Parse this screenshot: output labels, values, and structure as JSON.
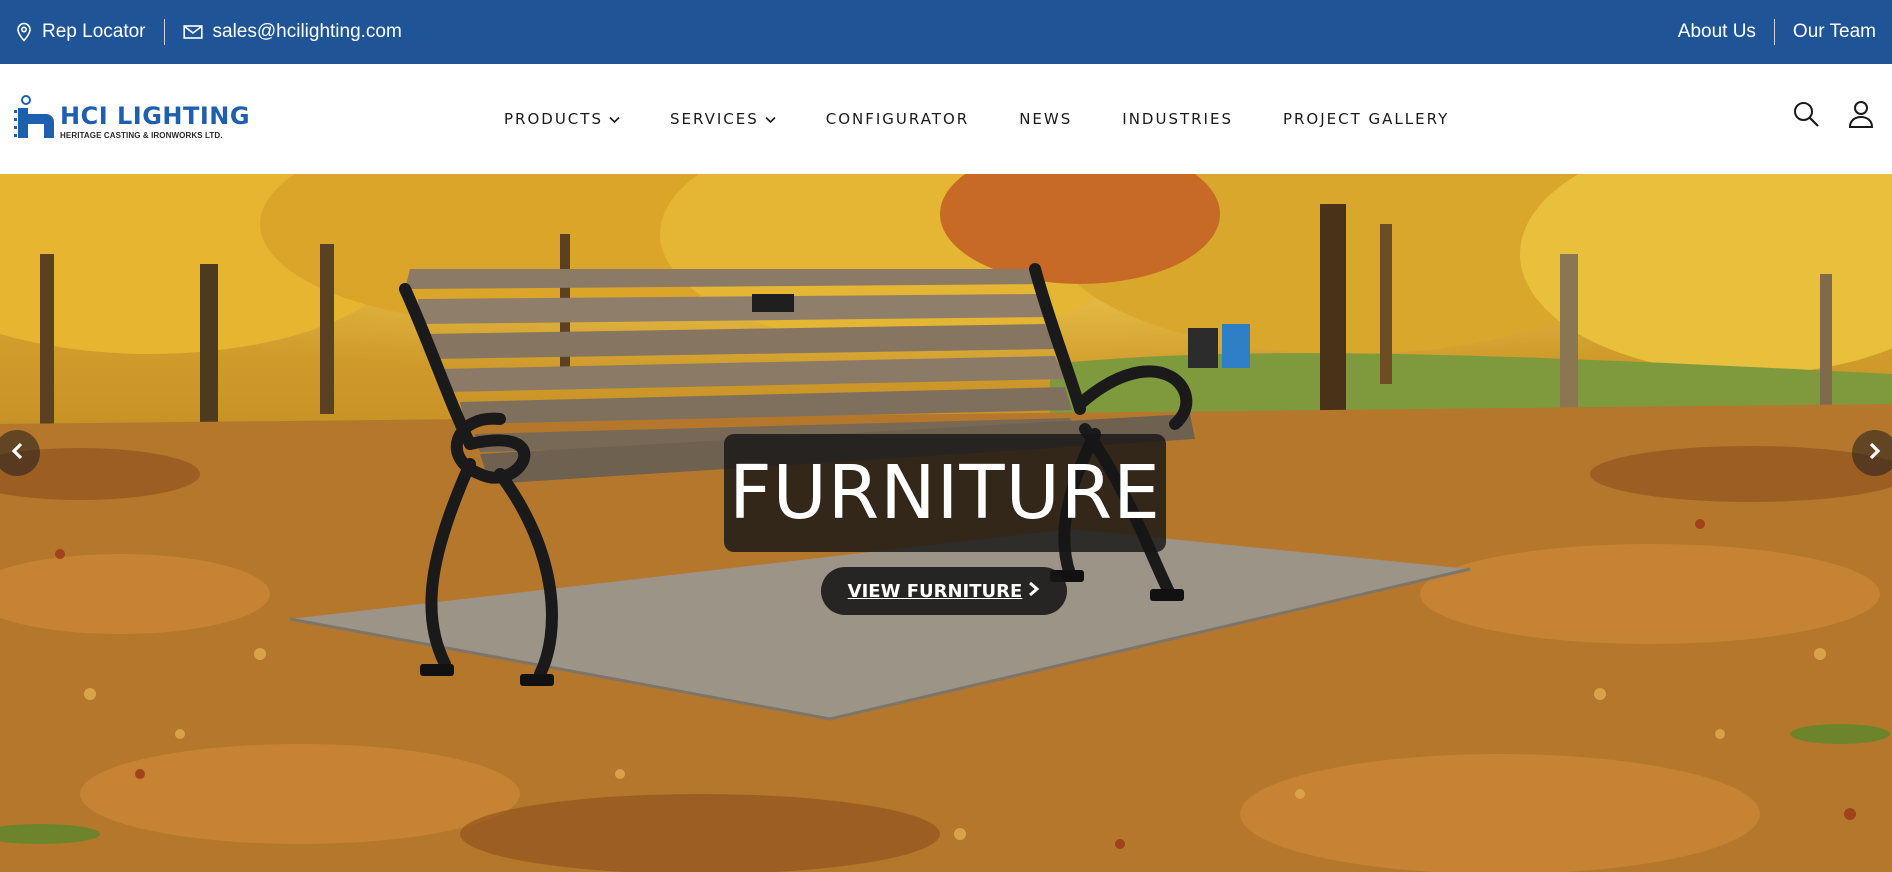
{
  "topbar": {
    "rep_locator": "Rep Locator",
    "email": "sales@hcilighting.com",
    "about": "About Us",
    "team": "Our Team"
  },
  "logo": {
    "name": "HCI LIGHTING",
    "tagline": "HERITAGE CASTING & IRONWORKS LTD."
  },
  "nav": {
    "items": [
      {
        "label": "PRODUCTS",
        "dropdown": true
      },
      {
        "label": "SERVICES",
        "dropdown": true
      },
      {
        "label": "CONFIGURATOR",
        "dropdown": false
      },
      {
        "label": "NEWS",
        "dropdown": false
      },
      {
        "label": "INDUSTRIES",
        "dropdown": false
      },
      {
        "label": "PROJECT GALLERY",
        "dropdown": false
      }
    ]
  },
  "header_icons": [
    "search-icon",
    "user-icon"
  ],
  "hero": {
    "title": "FURNITURE",
    "cta": "VIEW FURNITURE",
    "cta_icon": "chevron-right-icon",
    "prev_icon": "chevron-left-icon",
    "next_icon": "chevron-right-icon"
  },
  "colors": {
    "topbar_bg": "#1f5597",
    "logo_blue": "#1f5fb0",
    "caption_bg": "#161616"
  }
}
